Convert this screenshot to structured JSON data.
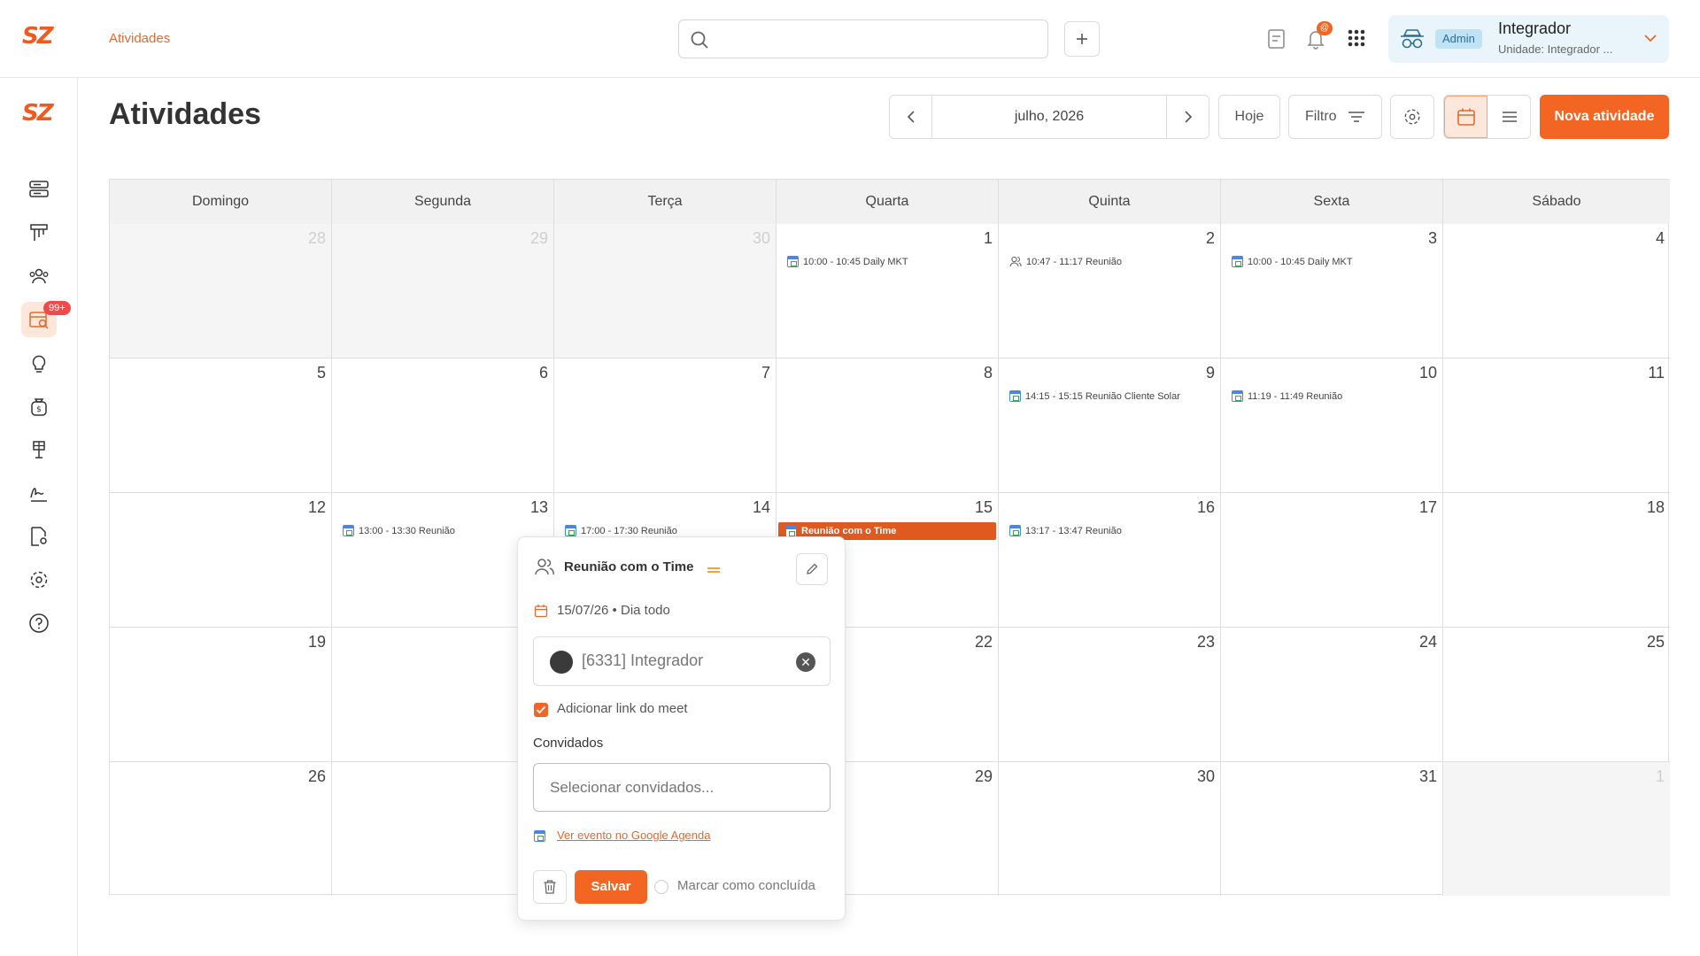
{
  "topbar": {
    "logo": "SZ",
    "breadcrumb": "Atividades",
    "search_placeholder": "",
    "notification_badge": "@",
    "user": {
      "role_badge": "Admin",
      "name": "Integrador",
      "unit": "Unidade: Integrador ..."
    }
  },
  "sidebar": {
    "logo": "SZ",
    "badge": "99+"
  },
  "page": {
    "title": "Atividades",
    "month_label": "julho, 2026",
    "today_label": "Hoje",
    "filter_label": "Filtro",
    "new_button": "Nova atividade"
  },
  "calendar": {
    "weekdays": [
      "Domingo",
      "Segunda",
      "Terça",
      "Quarta",
      "Quinta",
      "Sexta",
      "Sábado"
    ],
    "weeks": [
      [
        {
          "day": "28",
          "out": true,
          "events": []
        },
        {
          "day": "29",
          "out": true,
          "events": []
        },
        {
          "day": "30",
          "out": true,
          "events": []
        },
        {
          "day": "1",
          "events": [
            {
              "text": "10:00 - 10:45 Daily MKT",
              "icon": "google-calendar-icon"
            }
          ]
        },
        {
          "day": "2",
          "events": [
            {
              "text": "10:47 - 11:17 Reunião",
              "icon": "people-icon"
            }
          ]
        },
        {
          "day": "3",
          "events": [
            {
              "text": "10:00 - 10:45 Daily MKT",
              "icon": "google-calendar-icon"
            }
          ]
        },
        {
          "day": "4",
          "events": []
        }
      ],
      [
        {
          "day": "5",
          "events": []
        },
        {
          "day": "6",
          "events": []
        },
        {
          "day": "7",
          "events": []
        },
        {
          "day": "8",
          "events": []
        },
        {
          "day": "9",
          "events": [
            {
              "text": "14:15 - 15:15 Reunião Cliente Solar",
              "icon": "google-calendar-icon"
            }
          ]
        },
        {
          "day": "10",
          "events": [
            {
              "text": "11:19 - 11:49 Reunião",
              "icon": "google-calendar-icon"
            }
          ]
        },
        {
          "day": "11",
          "events": []
        }
      ],
      [
        {
          "day": "12",
          "events": []
        },
        {
          "day": "13",
          "events": [
            {
              "text": "13:00 - 13:30 Reunião",
              "icon": "google-calendar-icon"
            }
          ]
        },
        {
          "day": "14",
          "events": [
            {
              "text": "17:00 - 17:30 Reunião",
              "icon": "google-calendar-icon"
            }
          ]
        },
        {
          "day": "15",
          "events": [
            {
              "text": "Reunião com o Time",
              "icon": "google-calendar-icon",
              "highlight": true
            }
          ]
        },
        {
          "day": "16",
          "events": [
            {
              "text": "13:17 - 13:47 Reunião",
              "icon": "google-calendar-icon"
            }
          ]
        },
        {
          "day": "17",
          "events": []
        },
        {
          "day": "18",
          "events": []
        }
      ],
      [
        {
          "day": "19",
          "events": []
        },
        {
          "day": "",
          "events": []
        },
        {
          "day": "",
          "events": []
        },
        {
          "day": "22",
          "events": []
        },
        {
          "day": "23",
          "events": []
        },
        {
          "day": "24",
          "events": []
        },
        {
          "day": "25",
          "events": []
        }
      ],
      [
        {
          "day": "26",
          "events": []
        },
        {
          "day": "",
          "events": []
        },
        {
          "day": "",
          "events": []
        },
        {
          "day": "29",
          "events": []
        },
        {
          "day": "30",
          "events": []
        },
        {
          "day": "31",
          "events": []
        },
        {
          "day": "1",
          "out": true,
          "events": []
        }
      ]
    ]
  },
  "popup": {
    "title": "Reunião com o Time",
    "date": "15/07/26",
    "all_day": "Dia todo",
    "assignee": "[6331] Integrador",
    "meet_checkbox_label": "Adicionar link do meet",
    "meet_checked": true,
    "guests_label": "Convidados",
    "guests_placeholder": "Selecionar convidados...",
    "google_link": "Ver evento no Google Agenda",
    "save_button": "Salvar",
    "complete_label": "Marcar como concluída"
  },
  "colors": {
    "accent": "#f26522",
    "accent_light": "#fde6da",
    "highlight_event": "#e05a20",
    "admin_badge_bg": "#bfe3f5"
  }
}
